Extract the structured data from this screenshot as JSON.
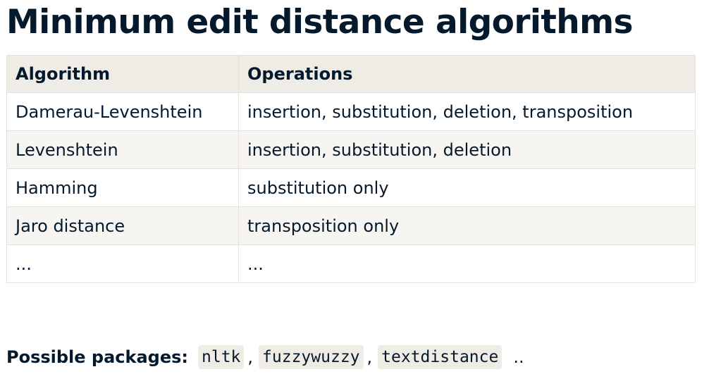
{
  "title": "Minimum edit distance algorithms",
  "table": {
    "headers": [
      "Algorithm",
      "Operations"
    ],
    "rows": [
      [
        "Damerau-Levenshtein",
        "insertion, substitution, deletion, transposition"
      ],
      [
        "Levenshtein",
        "insertion, substitution, deletion"
      ],
      [
        "Hamming",
        "substitution only"
      ],
      [
        "Jaro distance",
        "transposition only"
      ],
      [
        "...",
        "..."
      ]
    ]
  },
  "packages": {
    "label": "Possible packages:",
    "items": [
      "nltk",
      "fuzzywuzzy",
      "textdistance"
    ],
    "separator": ",",
    "trailing": ".."
  }
}
